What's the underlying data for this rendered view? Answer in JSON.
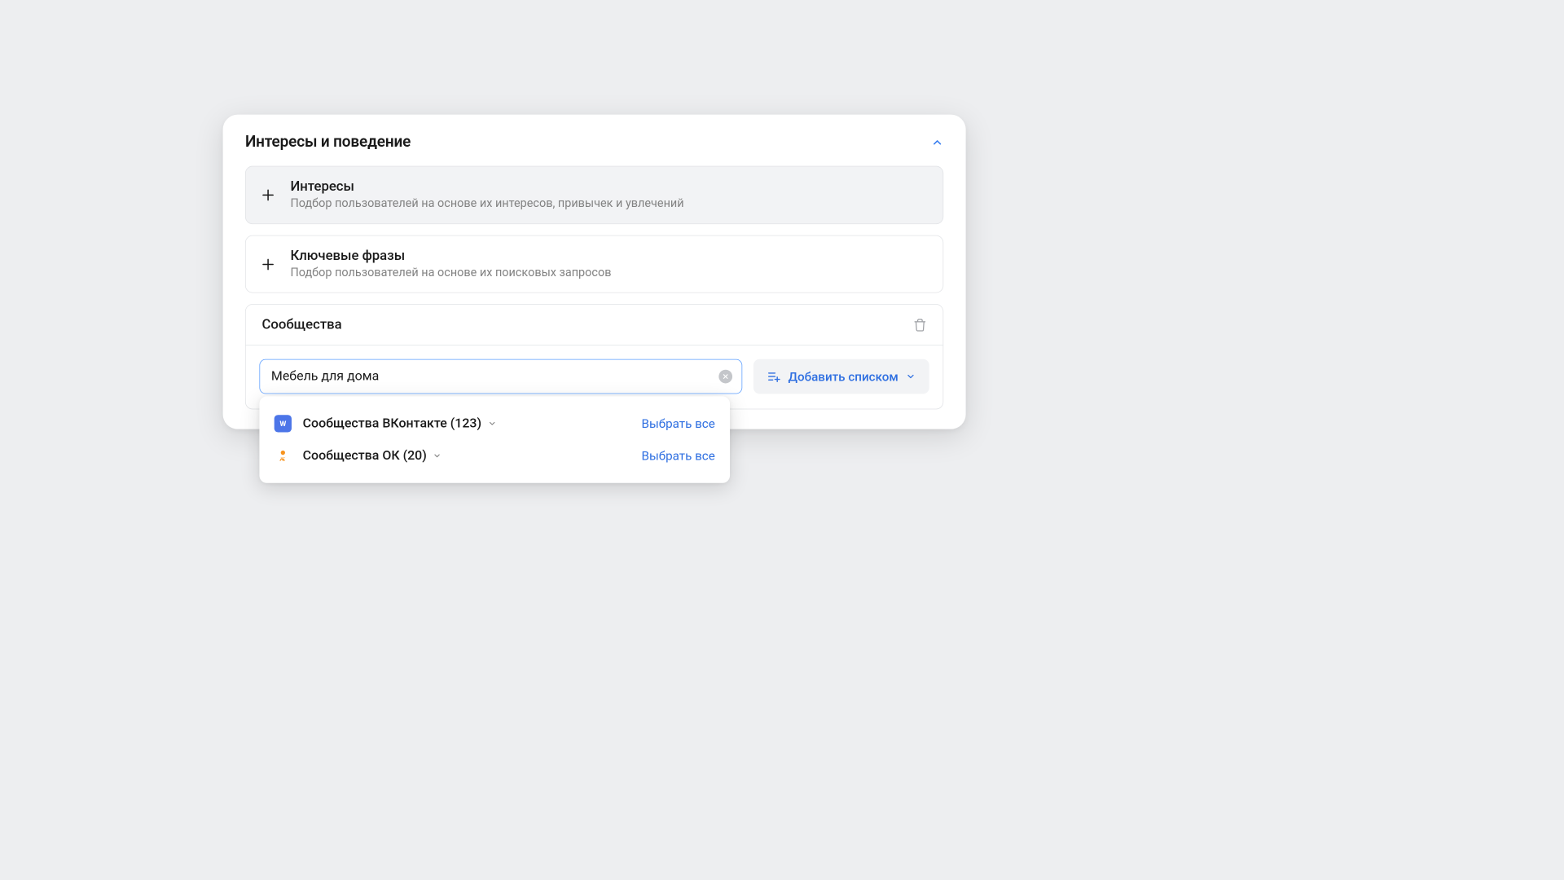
{
  "header": {
    "title": "Интересы и поведение"
  },
  "options": {
    "interests": {
      "title": "Интересы",
      "description": "Подбор пользователей на основе их интересов, привычек и увлечений"
    },
    "keywords": {
      "title": "Ключевые фразы",
      "description": "Подбор пользователей на основе их поисковых запросов"
    }
  },
  "communities": {
    "title": "Сообщества",
    "search_value": "Мебель для дома",
    "add_list_label": "Добавить списком"
  },
  "dropdown": {
    "rows": [
      {
        "label": "Сообщества ВКонтакте (123)",
        "select_all": "Выбрать все"
      },
      {
        "label": "Сообщества ОК (20)",
        "select_all": "Выбрать все"
      }
    ]
  }
}
